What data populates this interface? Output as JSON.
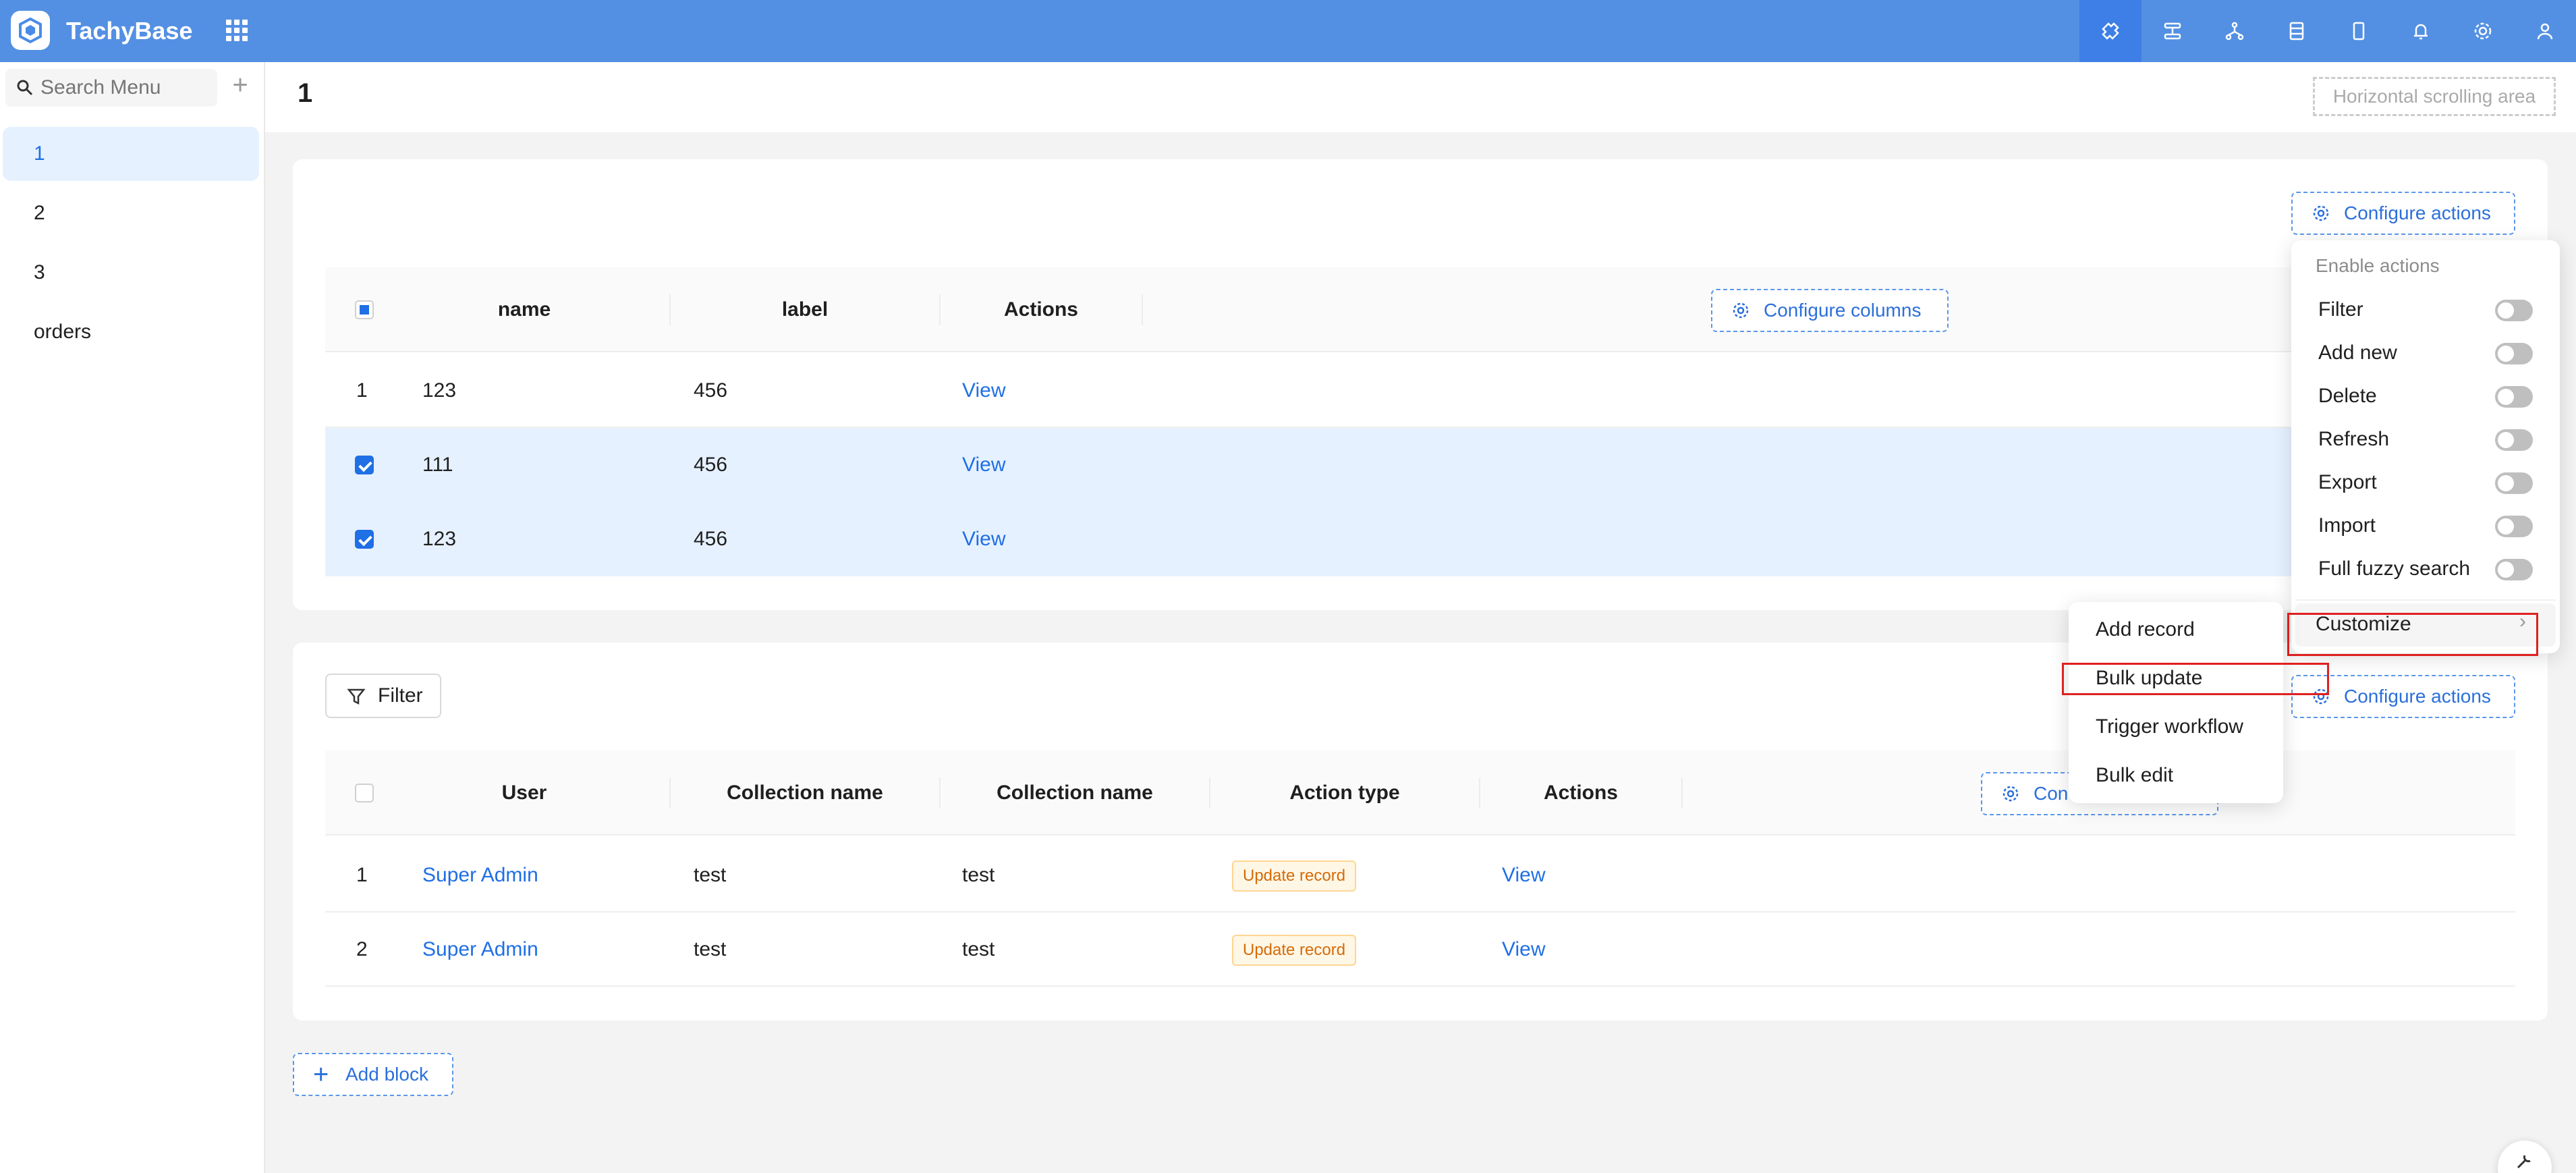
{
  "app": {
    "title": "TachyBase",
    "brand_color": "#5390e3"
  },
  "header_icons": [
    "puzzle-icon",
    "workflow-icon",
    "branch-icon",
    "table-icon",
    "mobile-icon",
    "bell-icon",
    "gear-icon",
    "user-icon"
  ],
  "sidebar": {
    "search_placeholder": "Search Menu",
    "items": [
      {
        "label": "1",
        "selected": true
      },
      {
        "label": "2"
      },
      {
        "label": "3"
      },
      {
        "label": "orders"
      }
    ]
  },
  "page": {
    "title": "1",
    "hscroll_label": "Horizontal scrolling area"
  },
  "block1": {
    "configure_actions": "Configure actions",
    "configure_columns": "Configure columns",
    "columns": [
      "name",
      "label",
      "Actions"
    ],
    "rows": [
      {
        "index": "1",
        "name": "123",
        "label": "456",
        "action": "View",
        "selected": false
      },
      {
        "index": "",
        "name": "111",
        "label": "456",
        "action": "View",
        "selected": true
      },
      {
        "index": "",
        "name": "123",
        "label": "456",
        "action": "View",
        "selected": true
      }
    ]
  },
  "block2": {
    "filter_label": "Filter",
    "configure_actions": "Configure actions",
    "configure_columns_partial": "Con",
    "columns": [
      "User",
      "Collection name",
      "Collection name",
      "Action type",
      "Actions"
    ],
    "rows": [
      {
        "index": "1",
        "user": "Super Admin",
        "collection1": "test",
        "collection2": "test",
        "action_type": "Update record",
        "action": "View"
      },
      {
        "index": "2",
        "user": "Super Admin",
        "collection1": "test",
        "collection2": "test",
        "action_type": "Update record",
        "action": "View"
      }
    ]
  },
  "add_block": "Add block",
  "actions_menu": {
    "title": "Enable actions",
    "options": [
      "Filter",
      "Add new",
      "Delete",
      "Refresh",
      "Export",
      "Import",
      "Full fuzzy search"
    ],
    "customize": "Customize"
  },
  "customize_menu": {
    "items": [
      "Add record",
      "Bulk update",
      "Trigger workflow",
      "Bulk edit"
    ]
  }
}
